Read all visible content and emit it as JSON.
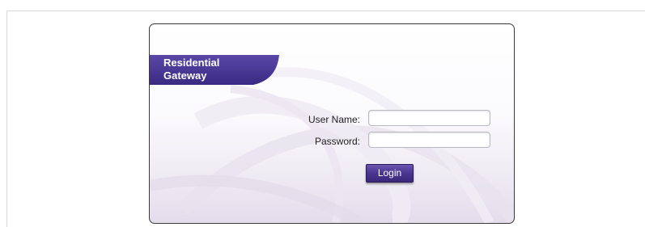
{
  "brand": {
    "line1": "Residential",
    "line2": "Gateway"
  },
  "form": {
    "username_label": "User Name:",
    "username_value": "",
    "password_label": "Password:",
    "password_value": "",
    "login_label": "Login"
  },
  "colors": {
    "brand_purple": "#4b3a9a",
    "button_purple": "#4a3590",
    "panel_border": "#3a3a3a"
  }
}
